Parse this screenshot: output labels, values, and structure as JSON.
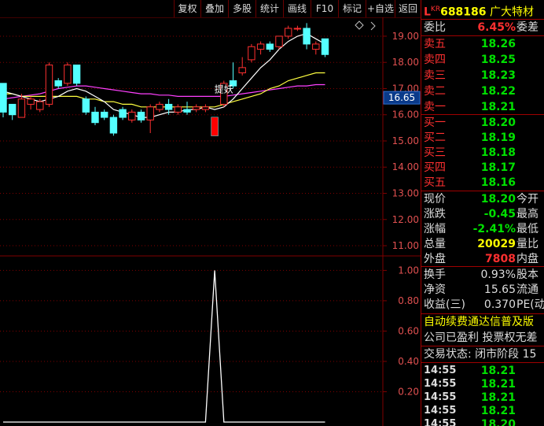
{
  "toolbar": {
    "buttons": [
      "复权",
      "叠加",
      "多股",
      "统计",
      "画线",
      "F10",
      "标记",
      "+自选",
      "返回"
    ]
  },
  "stock": {
    "prefix": "L",
    "badge": "KR",
    "code": "688186",
    "name": "广大特材"
  },
  "quote": {
    "weibi_label": "委比",
    "weibi_value": "6.45%",
    "weicha_label": "委差",
    "asks": [
      {
        "label": "卖五",
        "price": "18.26"
      },
      {
        "label": "卖四",
        "price": "18.25"
      },
      {
        "label": "卖三",
        "price": "18.23"
      },
      {
        "label": "卖二",
        "price": "18.22"
      },
      {
        "label": "卖一",
        "price": "18.21"
      }
    ],
    "bids": [
      {
        "label": "买一",
        "price": "18.20"
      },
      {
        "label": "买二",
        "price": "18.19"
      },
      {
        "label": "买三",
        "price": "18.18"
      },
      {
        "label": "买四",
        "price": "18.17"
      },
      {
        "label": "买五",
        "price": "18.16"
      }
    ],
    "stats": [
      {
        "label": "现价",
        "value": "18.20",
        "label2": "今开",
        "color": "grn"
      },
      {
        "label": "涨跌",
        "value": "-0.45",
        "label2": "最高",
        "color": "grn"
      },
      {
        "label": "涨幅",
        "value": "-2.41%",
        "label2": "最低",
        "color": "grn"
      },
      {
        "label": "总量",
        "value": "20029",
        "label2": "量比",
        "color": "yel"
      },
      {
        "label": "外盘",
        "value": "7808",
        "label2": "内盘",
        "color": "red"
      }
    ],
    "stats2": [
      {
        "label": "换手",
        "value": "0.93%",
        "label2": "股本"
      },
      {
        "label": "净资",
        "value": "15.65",
        "label2": "流通"
      },
      {
        "label": "收益(三)",
        "value": "0.370",
        "label2": "PE(动"
      }
    ],
    "notice1": "自动续费通达信普及版",
    "notice2": "公司已盈利 投票权无差",
    "trade_status": "交易状态: 闭市阶段 15",
    "ticks": [
      {
        "time": "14:55",
        "price": "18.21"
      },
      {
        "time": "14:55",
        "price": "18.21"
      },
      {
        "time": "14:55",
        "price": "18.21"
      },
      {
        "time": "14:55",
        "price": "18.21"
      },
      {
        "time": "14:55",
        "price": "18.20"
      }
    ]
  },
  "colors": {
    "up": "#ff3030",
    "down": "#54ffff",
    "ma_white": "#ffffff",
    "ma_yellow": "#ffff40",
    "ma_magenta": "#ff40ff",
    "grid": "#800000",
    "axis_text": "#e05050",
    "volume_line": "#ffffff"
  },
  "chart_data": [
    {
      "type": "candlestick",
      "y_ticks": [
        "19.00",
        "18.00",
        "17.00",
        "16.00",
        "15.00",
        "14.00",
        "13.00",
        "12.00",
        "11.00"
      ],
      "ylim": [
        10.7,
        19.6
      ],
      "current_price_label": "16.65",
      "annotation": "提妖",
      "candles": [
        {
          "o": 17.2,
          "c": 16.1,
          "h": 17.2,
          "l": 15.9
        },
        {
          "o": 16.4,
          "c": 16.0,
          "h": 16.4,
          "l": 15.8
        },
        {
          "o": 15.9,
          "c": 16.6,
          "h": 16.8,
          "l": 15.9
        },
        {
          "o": 16.4,
          "c": 16.6,
          "h": 16.7,
          "l": 16.2
        },
        {
          "o": 16.2,
          "c": 16.5,
          "h": 16.6,
          "l": 16.1
        },
        {
          "o": 16.4,
          "c": 17.9,
          "h": 18.0,
          "l": 16.3
        },
        {
          "o": 17.3,
          "c": 17.1,
          "h": 17.4,
          "l": 17.0
        },
        {
          "o": 17.2,
          "c": 17.9,
          "h": 18.0,
          "l": 17.1
        },
        {
          "o": 17.9,
          "c": 17.2,
          "h": 17.9,
          "l": 17.1
        },
        {
          "o": 16.6,
          "c": 16.1,
          "h": 16.7,
          "l": 16.0
        },
        {
          "o": 16.1,
          "c": 15.7,
          "h": 16.3,
          "l": 15.6
        },
        {
          "o": 16.1,
          "c": 15.9,
          "h": 16.2,
          "l": 15.8
        },
        {
          "o": 15.9,
          "c": 15.3,
          "h": 16.0,
          "l": 15.2
        },
        {
          "o": 16.2,
          "c": 15.9,
          "h": 16.3,
          "l": 15.8
        },
        {
          "o": 15.8,
          "c": 16.1,
          "h": 16.2,
          "l": 15.7
        },
        {
          "o": 16.1,
          "c": 15.8,
          "h": 16.2,
          "l": 15.7
        },
        {
          "o": 15.8,
          "c": 16.3,
          "h": 16.4,
          "l": 15.3
        },
        {
          "o": 16.2,
          "c": 16.4,
          "h": 16.5,
          "l": 16.1
        },
        {
          "o": 16.4,
          "c": 16.2,
          "h": 16.6,
          "l": 16.0
        },
        {
          "o": 16.1,
          "c": 16.3,
          "h": 16.4,
          "l": 16.0
        },
        {
          "o": 16.2,
          "c": 16.1,
          "h": 16.5,
          "l": 16.0
        },
        {
          "o": 16.2,
          "c": 16.3,
          "h": 16.4,
          "l": 16.1
        },
        {
          "o": 16.2,
          "c": 16.3,
          "h": 16.4,
          "l": 16.1
        },
        {
          "o": 15.9,
          "c": 15.2,
          "h": 15.9,
          "l": 15.2
        },
        {
          "o": 16.4,
          "c": 17.2,
          "h": 17.3,
          "l": 16.3
        },
        {
          "o": 17.3,
          "c": 17.1,
          "h": 18.0,
          "l": 17.0
        },
        {
          "o": 17.6,
          "c": 17.8,
          "h": 18.2,
          "l": 17.5
        },
        {
          "o": 18.1,
          "c": 18.6,
          "h": 18.7,
          "l": 18.0
        },
        {
          "o": 18.5,
          "c": 18.7,
          "h": 18.8,
          "l": 18.3
        },
        {
          "o": 18.7,
          "c": 18.5,
          "h": 18.8,
          "l": 18.4
        },
        {
          "o": 18.6,
          "c": 19.0,
          "h": 19.0,
          "l": 18.5
        },
        {
          "o": 19.0,
          "c": 19.3,
          "h": 19.4,
          "l": 18.9
        },
        {
          "o": 19.3,
          "c": 19.3,
          "h": 19.4,
          "l": 19.2
        },
        {
          "o": 19.3,
          "c": 18.7,
          "h": 19.5,
          "l": 18.5
        },
        {
          "o": 18.5,
          "c": 18.7,
          "h": 18.8,
          "l": 18.3
        },
        {
          "o": 18.9,
          "c": 18.3,
          "h": 18.9,
          "l": 18.2
        }
      ],
      "ma_white": [
        16.9,
        16.8,
        16.7,
        16.6,
        16.5,
        16.6,
        16.7,
        16.9,
        17.0,
        16.9,
        16.7,
        16.5,
        16.2,
        16.1,
        16.0,
        15.9,
        15.9,
        16.0,
        16.1,
        16.1,
        16.2,
        16.2,
        16.3,
        16.2,
        16.3,
        16.6,
        17.0,
        17.4,
        17.8,
        18.1,
        18.5,
        18.8,
        19.0,
        19.1,
        18.9,
        18.7
      ],
      "ma_yellow": [
        16.8,
        16.8,
        16.7,
        16.7,
        16.7,
        16.7,
        16.7,
        16.7,
        16.7,
        16.6,
        16.6,
        16.5,
        16.5,
        16.4,
        16.4,
        16.3,
        16.3,
        16.3,
        16.3,
        16.3,
        16.3,
        16.3,
        16.3,
        16.3,
        16.4,
        16.5,
        16.6,
        16.7,
        16.8,
        17.0,
        17.1,
        17.3,
        17.4,
        17.5,
        17.6,
        17.6
      ],
      "ma_magenta": [
        16.6,
        16.65,
        16.7,
        16.75,
        16.8,
        16.9,
        17.0,
        17.05,
        17.1,
        17.1,
        17.05,
        17.0,
        16.95,
        16.9,
        16.85,
        16.8,
        16.8,
        16.75,
        16.75,
        16.7,
        16.7,
        16.7,
        16.7,
        16.7,
        16.7,
        16.75,
        16.8,
        16.85,
        16.9,
        16.95,
        17.0,
        17.05,
        17.1,
        17.1,
        17.15,
        17.15
      ]
    },
    {
      "type": "line",
      "y_ticks": [
        "1.00",
        "0.80",
        "0.60",
        "0.40",
        "0.20"
      ],
      "ylim": [
        0,
        1.08
      ],
      "values": [
        0,
        0,
        0,
        0,
        0,
        0,
        0,
        0,
        0,
        0,
        0,
        0,
        0,
        0,
        0,
        0,
        0,
        0,
        0,
        0,
        0,
        0,
        0,
        1,
        0,
        0,
        0,
        0,
        0,
        0,
        0,
        0,
        0,
        0,
        0,
        0
      ]
    }
  ]
}
